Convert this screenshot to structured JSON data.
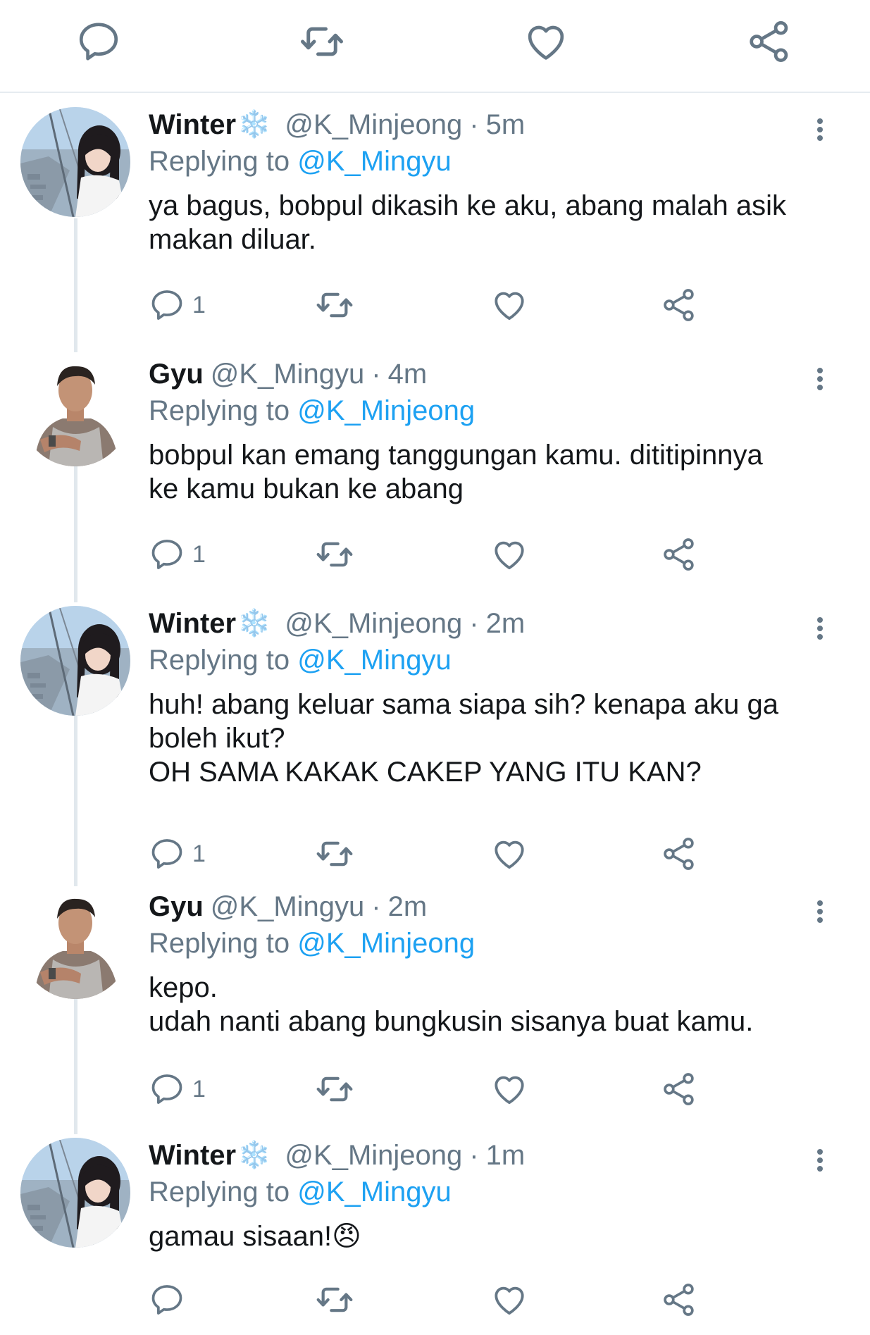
{
  "top_bar": {
    "icons": [
      "reply-icon",
      "retweet-icon",
      "like-icon",
      "share-icon"
    ]
  },
  "colors": {
    "link": "#1da1f2",
    "muted": "#657786",
    "text": "#14171a",
    "divider": "#e6ecf0"
  },
  "tweets": [
    {
      "name": "Winter",
      "emoji": "❄️",
      "handle": "@K_Minjeong",
      "dot": "·",
      "time": "5m",
      "replying_prefix": "Replying to ",
      "replying_to": "@K_Mingyu",
      "text": "ya bagus, bobpul dikasih ke aku, abang malah asik\nmakan diluar.",
      "reply_count": "1"
    },
    {
      "name": "Gyu",
      "emoji": "",
      "handle": "@K_Mingyu",
      "dot": "·",
      "time": "4m",
      "replying_prefix": "Replying to ",
      "replying_to": "@K_Minjeong",
      "text": "bobpul kan emang tanggungan kamu. dititipinnya\nke kamu bukan ke abang",
      "reply_count": "1"
    },
    {
      "name": "Winter",
      "emoji": "❄️",
      "handle": "@K_Minjeong",
      "dot": "·",
      "time": "2m",
      "replying_prefix": "Replying to ",
      "replying_to": "@K_Mingyu",
      "text": "huh! abang keluar sama siapa sih? kenapa aku ga\nboleh ikut?\nOH SAMA KAKAK CAKEP YANG ITU KAN?",
      "reply_count": "1"
    },
    {
      "name": "Gyu",
      "emoji": "",
      "handle": "@K_Mingyu",
      "dot": "·",
      "time": "2m",
      "replying_prefix": "Replying to ",
      "replying_to": "@K_Minjeong",
      "text": "kepo.\nudah nanti abang bungkusin sisanya buat kamu.",
      "reply_count": "1"
    },
    {
      "name": "Winter",
      "emoji": "❄️",
      "handle": "@K_Minjeong",
      "dot": "·",
      "time": "1m",
      "replying_prefix": "Replying to ",
      "replying_to": "@K_Mingyu",
      "text": "gamau sisaan!😠",
      "reply_count": ""
    }
  ]
}
